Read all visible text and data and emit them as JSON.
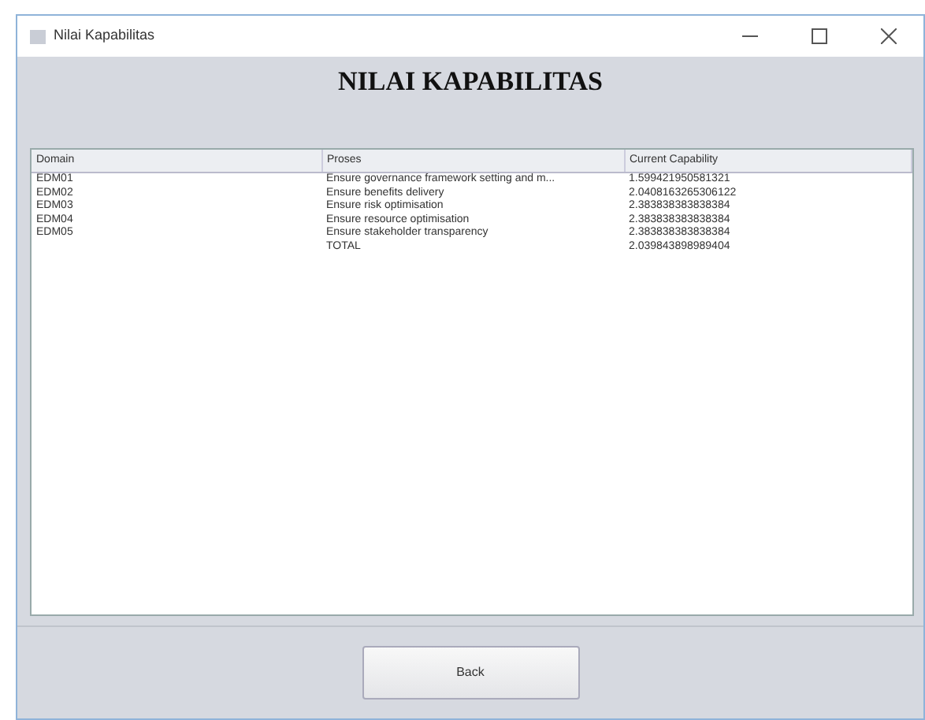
{
  "window": {
    "title": "Nilai Kapabilitas"
  },
  "heading": "NILAI KAPABILITAS",
  "table": {
    "columns": [
      "Domain",
      "Proses",
      "Current Capability"
    ],
    "rows": [
      [
        "EDM01",
        "Ensure governance framework setting and m...",
        "1.599421950581321"
      ],
      [
        "EDM02",
        "Ensure benefits delivery",
        "2.0408163265306122"
      ],
      [
        "EDM03",
        "Ensure risk optimisation",
        "2.383838383838384"
      ],
      [
        "EDM04",
        "Ensure resource optimisation",
        "2.383838383838384"
      ],
      [
        "EDM05",
        "Ensure stakeholder transparency",
        "2.383838383838384"
      ],
      [
        "",
        "TOTAL",
        "2.039843898989404"
      ]
    ]
  },
  "buttons": [
    "Back"
  ]
}
